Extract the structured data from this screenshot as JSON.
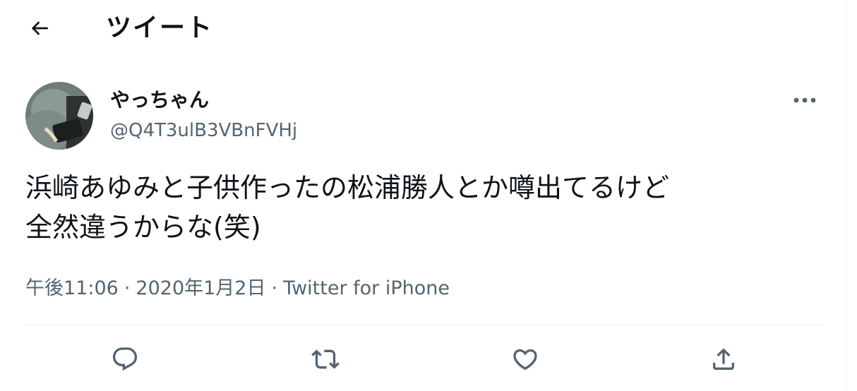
{
  "header": {
    "title": "ツイート",
    "back_icon": "arrow-left-icon"
  },
  "tweet": {
    "display_name": "やっちゃん",
    "handle": "@Q4T3ulB3VBnFVHj",
    "text_line1": "浜崎あゆみと子供作ったの松浦勝人とか噂出てるけど",
    "text_line2": "全然違うからな(笑)",
    "time": "午後11:06",
    "date": "2020年1月2日",
    "source": "Twitter for iPhone",
    "separator": "·"
  },
  "actions": [
    {
      "name": "reply",
      "icon": "reply-icon"
    },
    {
      "name": "retweet",
      "icon": "retweet-icon"
    },
    {
      "name": "like",
      "icon": "heart-icon"
    },
    {
      "name": "share",
      "icon": "share-icon"
    }
  ],
  "colors": {
    "text": "#0f1419",
    "secondary": "#536471",
    "divider": "#eff3f4"
  }
}
